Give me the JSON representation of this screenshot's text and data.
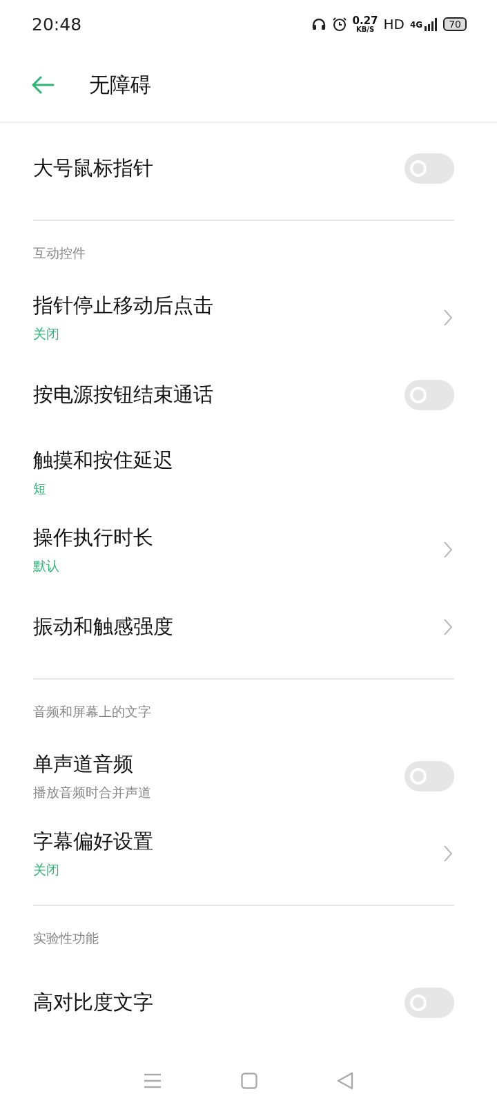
{
  "status_bar": {
    "time": "20:48",
    "speed_value": "0.27",
    "speed_unit": "KB/S",
    "hd": "HD",
    "network": "4G",
    "battery": "70"
  },
  "header": {
    "title": "无障碍"
  },
  "sections": [
    {
      "items": [
        {
          "kind": "toggle",
          "title": "大号鼠标指针",
          "on": false
        }
      ]
    },
    {
      "header": "互动控件",
      "items": [
        {
          "kind": "link",
          "title": "指针停止移动后点击",
          "value": "关闭"
        },
        {
          "kind": "toggle",
          "title": "按电源按钮结束通话",
          "on": false
        },
        {
          "kind": "plain",
          "title": "触摸和按住延迟",
          "value": "短"
        },
        {
          "kind": "link",
          "title": "操作执行时长",
          "value": "默认"
        },
        {
          "kind": "link",
          "title": "振动和触感强度"
        }
      ]
    },
    {
      "header": "音频和屏幕上的文字",
      "items": [
        {
          "kind": "toggle",
          "title": "单声道音频",
          "summary": "播放音频时合并声道",
          "on": false
        },
        {
          "kind": "link",
          "title": "字幕偏好设置",
          "value": "关闭"
        }
      ]
    },
    {
      "header": "实验性功能",
      "items": [
        {
          "kind": "toggle",
          "title": "高对比度文字",
          "on": false
        }
      ]
    }
  ]
}
